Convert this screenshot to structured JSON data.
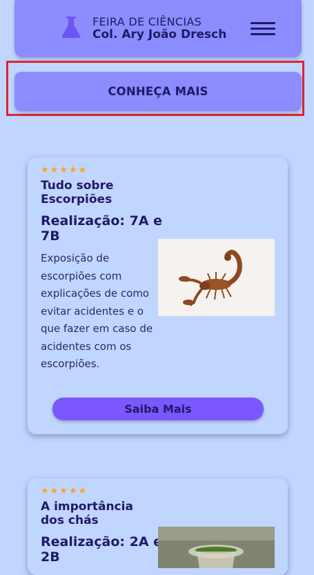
{
  "header": {
    "line1": "FEIRA DE CIÊNCIAS",
    "line2": "Col. Ary João Dresch",
    "logo_icon": "flask-icon",
    "menu_icon": "hamburger-menu-icon"
  },
  "cta": {
    "label": "CONHEÇA MAIS"
  },
  "cards": [
    {
      "stars": "★★★★★",
      "title": "Tudo sobre Escorpiões",
      "subtitle": "Realização: 7A e 7B",
      "description": "Exposição de escorpiões com explicações de como evitar acidentes e o que fazer em caso de acidentes com os escorpiões.",
      "image": "scorpion-image",
      "button_label": "Saiba Mais"
    },
    {
      "stars": "★★★★★",
      "title": "A importância dos chás",
      "subtitle": "Realização: 2A e 2B",
      "image": "tea-image"
    }
  ],
  "colors": {
    "background": "#c0d6ff",
    "header": "#8c8cff",
    "text": "#1f1a66",
    "button": "#7a57ff",
    "stars": "#f6a623",
    "highlight": "#e0232e"
  }
}
